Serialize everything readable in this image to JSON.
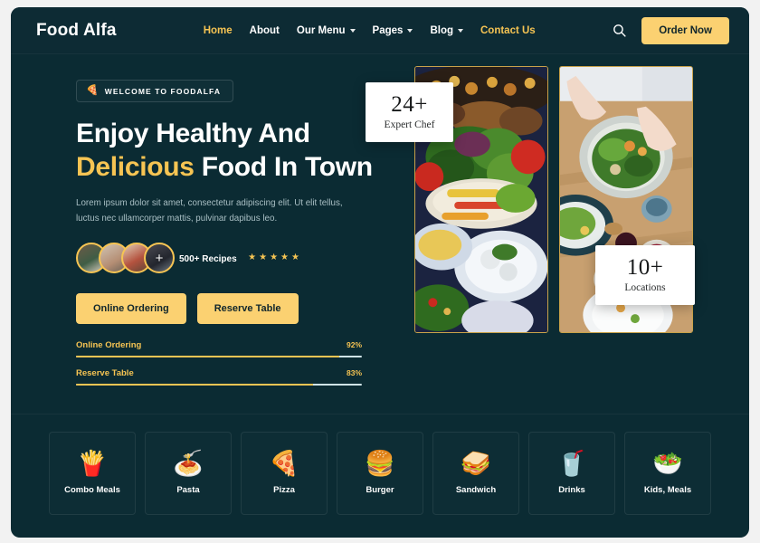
{
  "nav": {
    "logo": "Food Alfa",
    "links": [
      {
        "label": "Home",
        "dropdown": false,
        "state": "active"
      },
      {
        "label": "About",
        "dropdown": false,
        "state": "default"
      },
      {
        "label": "Our Menu",
        "dropdown": true,
        "state": "default"
      },
      {
        "label": "Pages",
        "dropdown": true,
        "state": "default"
      },
      {
        "label": "Blog",
        "dropdown": true,
        "state": "default"
      },
      {
        "label": "Contact Us",
        "dropdown": false,
        "state": "accent"
      }
    ],
    "search_icon": "search-icon",
    "order_button": "Order Now"
  },
  "hero": {
    "badge": {
      "icon": "pizza-slice-icon",
      "emoji": "🍕",
      "text": "WELCOME TO FOODALFA"
    },
    "headline_line1": "Enjoy Healthy And",
    "headline_highlight": "Delicious",
    "headline_line2_rest": " Food In Town",
    "paragraph": "Lorem ipsum dolor sit amet, consectetur adipiscing elit. Ut elit tellus, luctus nec ullamcorper mattis, pulvinar dapibus leo.",
    "avatars_count": 4,
    "avatar_plus": "+",
    "recipes_label": "500+ Recipes",
    "stars": 5,
    "buttons": [
      {
        "label": "Online Ordering"
      },
      {
        "label": "Reserve Table"
      }
    ],
    "skills": [
      {
        "name": "Online Ordering",
        "percent_label": "92%",
        "percent": 92
      },
      {
        "name": "Reserve Table",
        "percent_label": "83%",
        "percent": 83
      }
    ],
    "stat_cards": [
      {
        "number": "24+",
        "label": "Expert Chef"
      },
      {
        "number": "10+",
        "label": "Locations"
      }
    ],
    "photos": [
      {
        "name": "food-platter-photo"
      },
      {
        "name": "salad-table-photo"
      }
    ]
  },
  "categories": [
    {
      "label": "Combo Meals",
      "emoji": "🍟",
      "icon": "combo-meals-icon"
    },
    {
      "label": "Pasta",
      "emoji": "🍝",
      "icon": "pasta-icon"
    },
    {
      "label": "Pizza",
      "emoji": "🍕",
      "icon": "pizza-icon"
    },
    {
      "label": "Burger",
      "emoji": "🍔",
      "icon": "burger-icon"
    },
    {
      "label": "Sandwich",
      "emoji": "🥪",
      "icon": "sandwich-icon"
    },
    {
      "label": "Drinks",
      "emoji": "🥤",
      "icon": "drinks-icon"
    },
    {
      "label": "Kids, Meals",
      "emoji": "🥗",
      "icon": "kids-meals-icon"
    }
  ],
  "colors": {
    "background": "#0b2b33",
    "nav_background": "#0d2b34",
    "accent": "#f6c453",
    "button": "#fbd171",
    "text": "#ffffff",
    "muted_text": "#a9bfc4",
    "photo_border": "#c9a24a"
  }
}
